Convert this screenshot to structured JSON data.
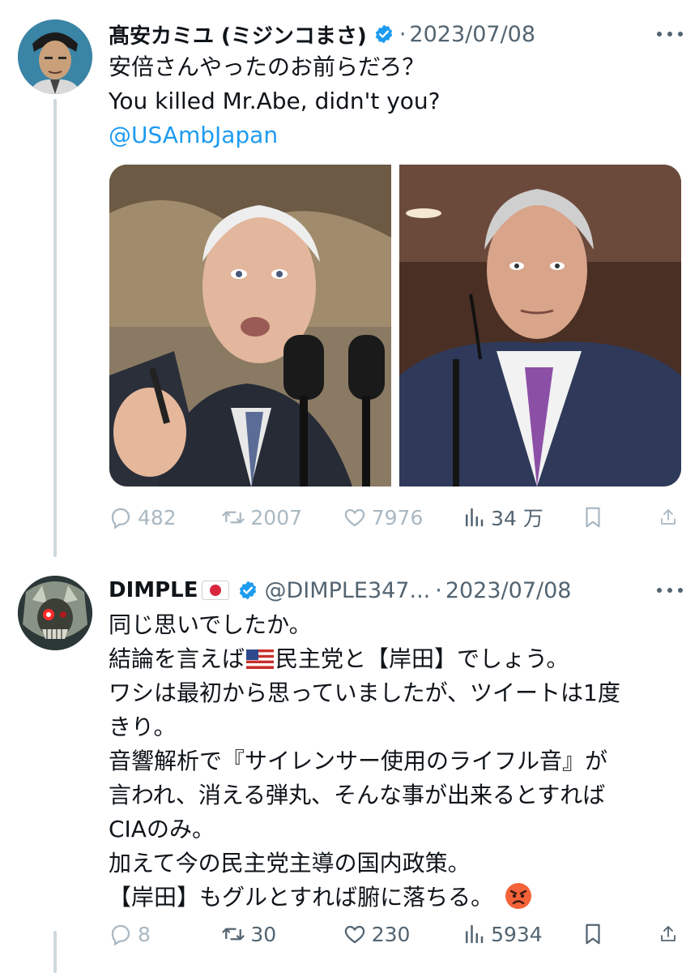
{
  "tweets": [
    {
      "name": "髙安カミユ (ミジンコまさ)",
      "handle": "",
      "date": "2023/07/08",
      "lines": [
        "安倍さんやったのお前らだろ？",
        "You killed Mr.Abe, didn't you?"
      ],
      "mention": "@USAmbJapan",
      "stats": {
        "replies": "482",
        "retweets": "2007",
        "likes": "7976",
        "views": "34 万"
      }
    },
    {
      "name": "DIMPLE",
      "handle": "@DIMPLE347...",
      "date": "2023/07/08",
      "lines": [
        "同じ思いでしたか。",
        "結論を言えば",
        "民主党と【岸田】でしょう。",
        "ワシは最初から思っていましたが、ツイートは1度",
        "きり。",
        "音響解析で『サイレンサー使用のライフル音』が",
        "言われ、消える弾丸、そんな事が出来るとすれば",
        "CIAのみ。",
        "加えて今の民主党主導の国内政策。",
        "【岸田】もグルとすれば腑に落ちる。"
      ],
      "stats": {
        "replies": "8",
        "retweets": "30",
        "likes": "230",
        "views": "5934"
      }
    }
  ],
  "icons": {
    "verified": "verified-badge-icon",
    "reply": "reply-icon",
    "retweet": "retweet-icon",
    "like": "heart-icon",
    "views": "views-chart-icon",
    "bookmark": "bookmark-icon",
    "share": "share-icon",
    "more": "more-dots-icon",
    "emoji": "angry-face-emoji"
  },
  "colors": {
    "accent": "#1d9bf0",
    "secondary": "#536471",
    "text": "#0f1419",
    "thread": "#cfd9de"
  }
}
